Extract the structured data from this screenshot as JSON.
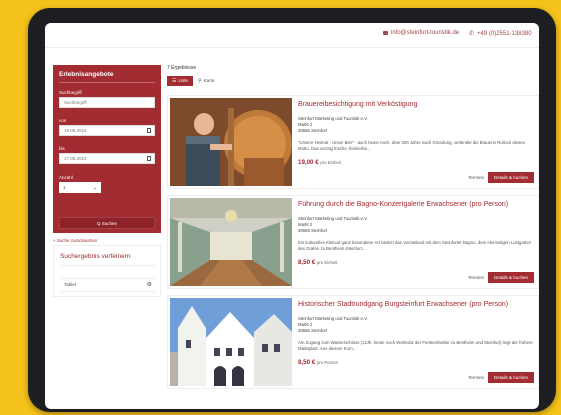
{
  "topbar": {
    "email": "info@steinfurt-touristik.de",
    "phone": "+49 (0)2551-138380"
  },
  "sidebar": {
    "title": "Erlebnisangebote",
    "search_label": "Suchbegriff",
    "search_placeholder": "Suchbegriff",
    "from_label": "von",
    "from_value": "19.09.2024",
    "to_label": "bis",
    "to_value": "17.09.2024",
    "count_label": "Anzahl",
    "count_value": "1",
    "search_button": "Q Suchen",
    "reset_link": "» Suche zurücksetzen"
  },
  "refine": {
    "title": "Suchergebnis verfeinern",
    "filter_label": "Tablet"
  },
  "results": {
    "count": "7 Ergebnisse",
    "view_list": "Liste",
    "view_map": "Karte"
  },
  "cards": [
    {
      "title": "Brauereibesichtigung mit Verköstigung",
      "addr_line1": "Steinfurt Marketing und Touristik e.V.",
      "addr_line2": "Markt 2",
      "addr_line3": "48565 Steinfurt",
      "desc": "\"Unsere Heimat - Unser Bier\" - auch heute noch, über 200 Jahre nach Gründung, verbindet die Brauerei Rolinck dieses Motto. Das vorzüg frische, feinherbe...",
      "price": "19,00 €",
      "price_unit": "pro Einheit",
      "termine": "Termine",
      "details": "Details & buchen"
    },
    {
      "title": "Führung durch die Bagno-Konzertgalerie Erwachsener (pro Person)",
      "addr_line1": "Steinfurt Marketing und Touristik e.V.",
      "addr_line2": "Markt 2",
      "addr_line3": "48565 Steinfurt",
      "desc": "Ein kulturelles Kleinod ganz besonderer Art besitzt das Vorsteiland mit dem Steinfurter Bagno, dem ehemaligen Lustgarten des Grafen zu Bentheim-Steinfurt...",
      "price": "8,50 €",
      "price_unit": "pro Einheit",
      "termine": "Termine",
      "details": "Details & buchen"
    },
    {
      "title": "Historischer Stadtrundgang Burgsteinfurt Erwachsener (pro Person)",
      "addr_line1": "Steinfurt Marketing und Touristik e.V.",
      "addr_line2": "Markt 2",
      "addr_line3": "48565 Steinfurt",
      "desc": "Am Zugang zum Wasserschloss (12Jh. heute noch Wohnsitz der Fürstenfamilie zu Bentheim und Steinfurt) liegt der frühere Marktplatz. Aus diesem Korn...",
      "price": "8,50 €",
      "price_unit": "pro Person",
      "termine": "Termine",
      "details": "Details & buchen"
    }
  ]
}
